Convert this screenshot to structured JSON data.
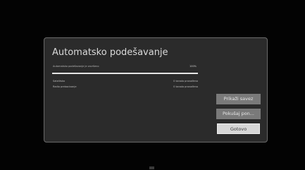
{
  "dialog": {
    "title": "Automatsko podešavanje",
    "status_label": "Automatsko podešavanje je završeno",
    "progress_text": "100%",
    "progress_fraction": 1.0,
    "channels": [
      {
        "name": "Satelitsko",
        "count": "0 kanala pronađeno"
      },
      {
        "name": "Radio prebacivanje",
        "count": "0 kanala pronađeno"
      }
    ],
    "buttons": {
      "show_label": "Prikaži savez",
      "retry_label": "Pokušaj pon...",
      "done_label": "Gotovo"
    }
  },
  "colors": {
    "background": "#030303",
    "dialog_background": "#2b2b2b",
    "button_default": "#7a7a7a",
    "button_focused": "#d7d7d7"
  }
}
